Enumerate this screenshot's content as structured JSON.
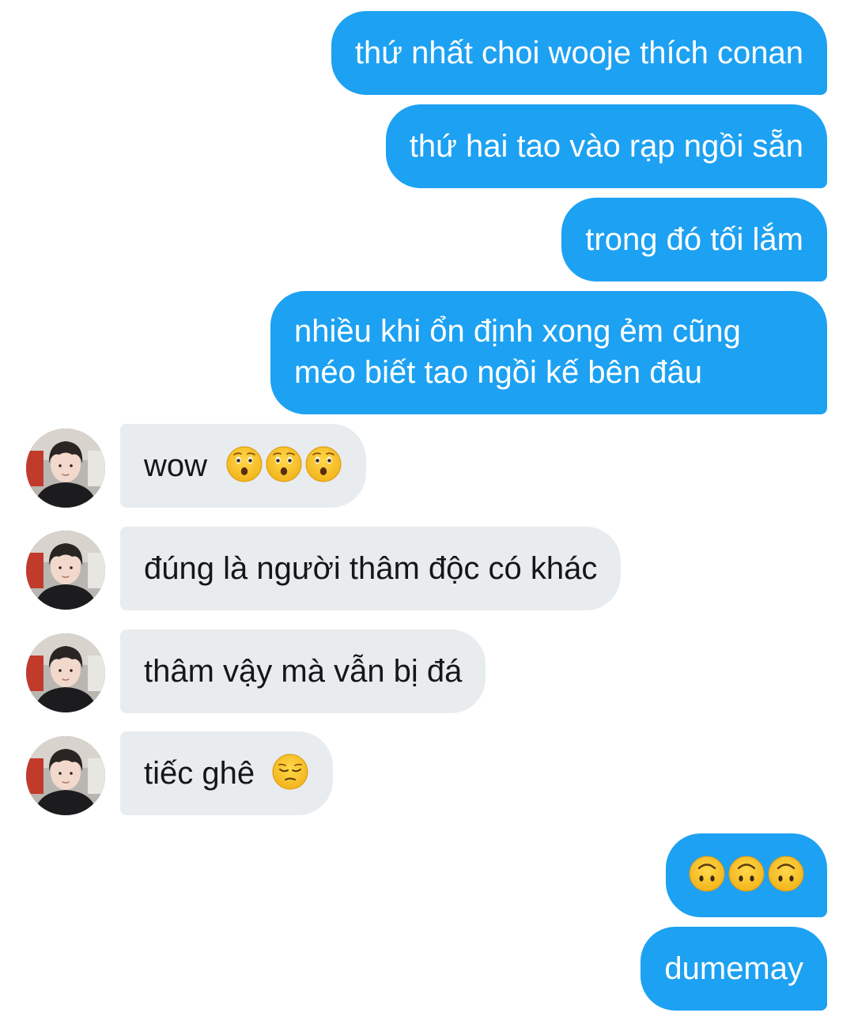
{
  "messages": [
    {
      "side": "sent",
      "text": "thứ nhất choi wooje thích conan"
    },
    {
      "side": "sent",
      "text": "thứ hai tao vào rạp ngồi sẵn"
    },
    {
      "side": "sent",
      "text": "trong đó tối lắm"
    },
    {
      "side": "sent",
      "lines": [
        "nhiều khi ổn định xong ẻm cũng",
        "méo biết tao ngồi kế bên đâu"
      ]
    },
    {
      "side": "received",
      "text": "wow",
      "emoji": [
        "hushed-face",
        "hushed-face",
        "hushed-face"
      ]
    },
    {
      "side": "received",
      "text": "đúng là người thâm độc có khác"
    },
    {
      "side": "received",
      "text": "thâm vậy mà vẫn bị đá"
    },
    {
      "side": "received",
      "text": "tiếc ghê",
      "emoji": [
        "pensive-face"
      ]
    },
    {
      "side": "sent",
      "emoji": [
        "upside-down-face",
        "upside-down-face",
        "upside-down-face"
      ]
    },
    {
      "side": "sent",
      "text": "dumemay"
    }
  ],
  "colors": {
    "sent_bubble": "#1da1f2",
    "received_bubble": "#e8ecef",
    "sent_text": "#ffffff",
    "received_text": "#14171a",
    "emoji_yellow": "#f7c325"
  }
}
